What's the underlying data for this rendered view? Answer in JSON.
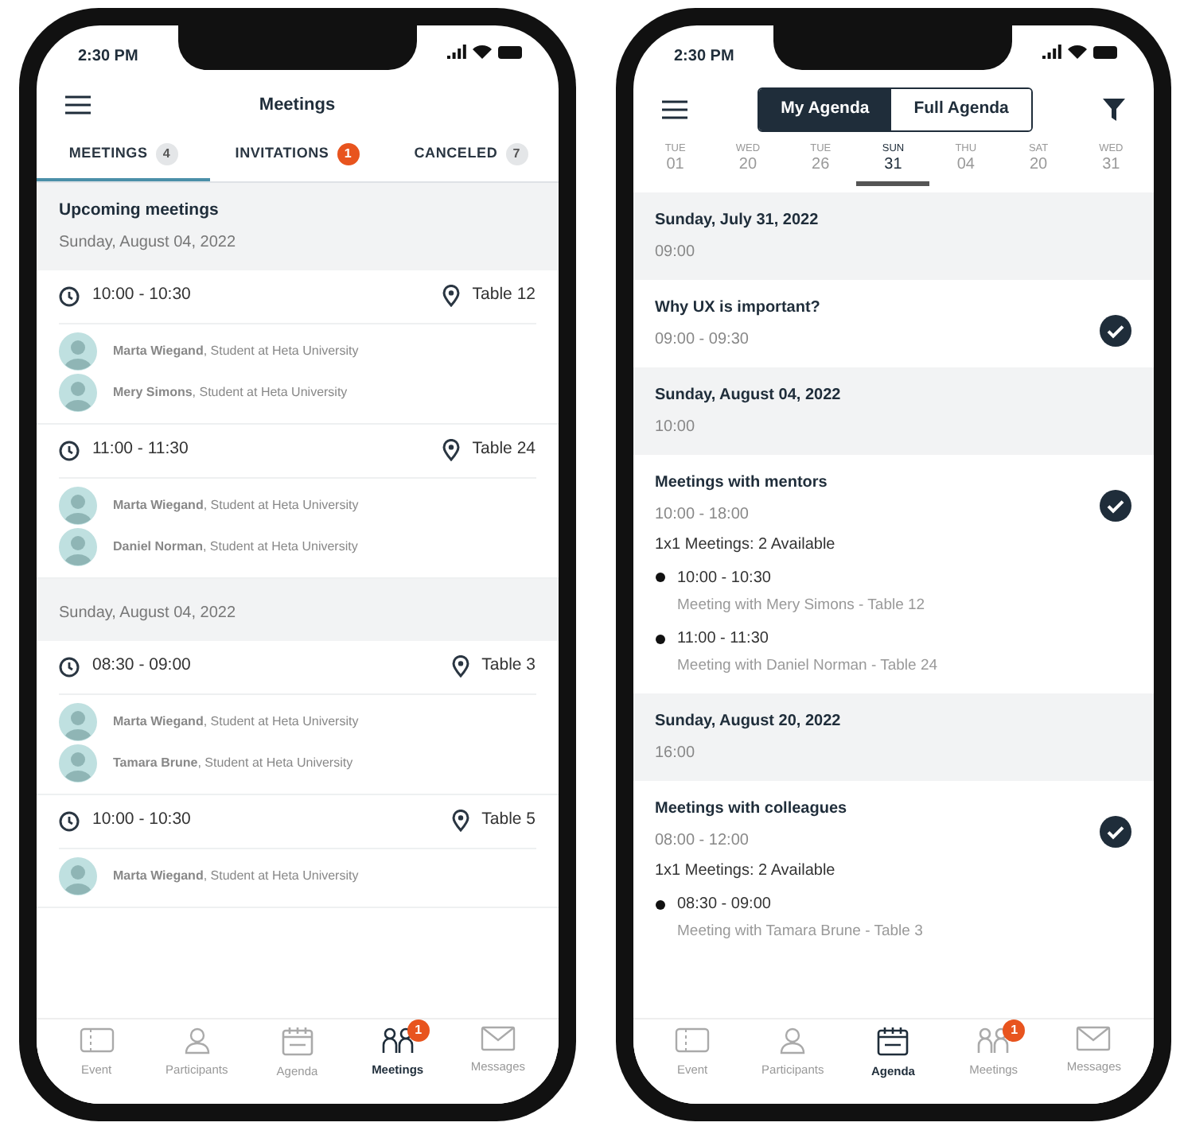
{
  "phones": [
    {
      "kind": "meetings",
      "status_bar": {
        "time": "2:30 PM"
      },
      "header": {
        "title": "Meetings"
      },
      "tabs": [
        {
          "label": "MEETINGS",
          "count": "4",
          "alert": false,
          "selected": true
        },
        {
          "label": "INVITATIONS",
          "count": "1",
          "alert": true,
          "selected": false
        },
        {
          "label": "CANCELED",
          "count": "7",
          "alert": false,
          "selected": false
        }
      ],
      "sections": [
        {
          "title": "Upcoming meetings",
          "date": "Sunday, August 04, 2022",
          "meetings": [
            {
              "time": "10:00 - 10:30",
              "table": "Table 12",
              "participants": [
                "**Marta Wiegand**, Student at Heta University",
                "**Mery Simons**, Student at Heta University"
              ]
            },
            {
              "time": "11:00 - 11:30",
              "table": "Table 24",
              "participants": [
                "**Marta Wiegand**, Student at Heta University",
                "**Daniel Norman**, Student at Heta University"
              ]
            }
          ]
        },
        {
          "date": "Sunday, August 04, 2022",
          "meetings": [
            {
              "time": "08:30 - 09:00",
              "table": "Table 3",
              "participants": [
                "**Marta Wiegand**, Student at Heta University",
                "**Tamara Brune**, Student at Heta University"
              ]
            },
            {
              "time": "10:00 - 10:30",
              "table": "Table 5",
              "participants": [
                "**Marta Wiegand**, Student at Heta University"
              ]
            }
          ]
        }
      ],
      "nav": [
        {
          "kind": "ticket",
          "label": "Event",
          "selected": false
        },
        {
          "kind": "person",
          "label": "Participants",
          "selected": false
        },
        {
          "kind": "calendar",
          "label": "Agenda",
          "selected": false
        },
        {
          "kind": "people",
          "label": "Meetings",
          "selected": true,
          "badge": "1"
        },
        {
          "kind": "envelope",
          "label": "Messages",
          "selected": false
        }
      ]
    },
    {
      "kind": "agenda",
      "status_bar": {
        "time": "2:30 PM"
      },
      "segments": [
        {
          "label": "My Agenda",
          "selected": true
        },
        {
          "label": "Full Agenda",
          "selected": false
        }
      ],
      "days": [
        {
          "weekday": "TUE",
          "day": "01",
          "selected": false
        },
        {
          "weekday": "WED",
          "day": "20",
          "selected": false
        },
        {
          "weekday": "TUE",
          "day": "26",
          "selected": false
        },
        {
          "weekday": "SUN",
          "day": "31",
          "selected": true
        },
        {
          "weekday": "THU",
          "day": "04",
          "selected": false
        },
        {
          "weekday": "SAT",
          "day": "20",
          "selected": false
        },
        {
          "weekday": "WED",
          "day": "31",
          "selected": false
        }
      ],
      "groups": [
        {
          "date": "Sunday, July 31, 2022",
          "time": "09:00",
          "sessions": [
            {
              "title": "Why UX is important?",
              "time": "09:00 - 09:30",
              "checked": true
            }
          ]
        },
        {
          "date": "Sunday, August 04, 2022",
          "time": "10:00",
          "sessions": [
            {
              "title": "Meetings with mentors",
              "time": "10:00 - 18:00",
              "note": "1x1 Meetings: 2 Available",
              "checked": true,
              "slots": [
                {
                  "time": "10:00 - 10:30",
                  "detail": "Meeting with Mery Simons - Table 12"
                },
                {
                  "time": "11:00 - 11:30",
                  "detail": "Meeting with Daniel Norman - Table 24"
                }
              ]
            }
          ]
        },
        {
          "date": "Sunday, August 20, 2022",
          "time": "16:00",
          "sessions": [
            {
              "title": "Meetings with colleagues",
              "time": "08:00 - 12:00",
              "note": "1x1 Meetings: 2 Available",
              "checked": true,
              "slots": [
                {
                  "time": "08:30 - 09:00",
                  "detail": "Meeting with Tamara Brune - Table 3"
                }
              ]
            }
          ]
        }
      ],
      "nav": [
        {
          "kind": "ticket",
          "label": "Event",
          "selected": false
        },
        {
          "kind": "person",
          "label": "Participants",
          "selected": false
        },
        {
          "kind": "calendar",
          "label": "Agenda",
          "selected": true
        },
        {
          "kind": "people",
          "label": "Meetings",
          "selected": false,
          "badge": "1"
        },
        {
          "kind": "envelope",
          "label": "Messages",
          "selected": false
        }
      ]
    }
  ]
}
